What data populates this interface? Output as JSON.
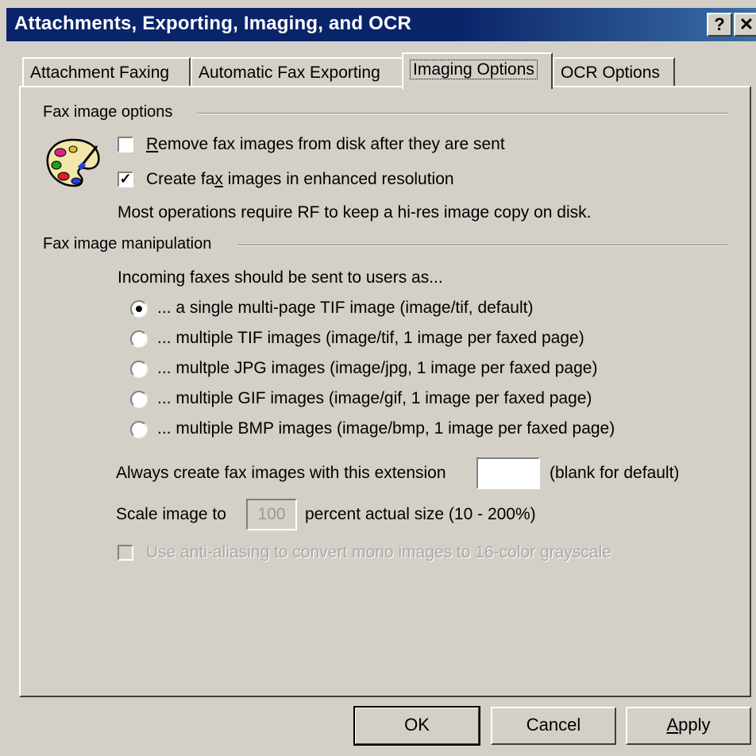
{
  "window": {
    "title": "Attachments, Exporting, Imaging, and OCR",
    "help_glyph": "?",
    "close_glyph": "✕"
  },
  "tabs": [
    {
      "label": "Attachment Faxing",
      "active": false
    },
    {
      "label": "Automatic Fax Exporting",
      "active": false
    },
    {
      "label": "Imaging Options",
      "active": true
    },
    {
      "label": "OCR Options",
      "active": false
    }
  ],
  "fax_image_options": {
    "group_label": "Fax image options",
    "icon": "palette-icon",
    "remove_images": {
      "label_prefix": "",
      "label_underline": "R",
      "label_rest": "emove fax images from disk after they are sent",
      "checked": false
    },
    "enhanced_resolution": {
      "label_prefix": "Create fa",
      "label_underline": "x",
      "label_rest": " images in enhanced resolution",
      "checked": true
    },
    "note": "Most operations require RF to keep a hi-res image copy on disk."
  },
  "fax_image_manipulation": {
    "group_label": "Fax image manipulation",
    "prompt": "Incoming faxes should be sent to users as...",
    "options": [
      {
        "label": "... a single multi-page TIF image (image/tif, default)",
        "selected": true
      },
      {
        "label": "... multiple TIF images (image/tif, 1 image per faxed page)",
        "selected": false
      },
      {
        "label": "... multple JPG images (image/jpg, 1 image per faxed page)",
        "selected": false
      },
      {
        "label": "... multiple GIF images (image/gif, 1 image per faxed page)",
        "selected": false
      },
      {
        "label": "... multiple BMP images (image/bmp, 1 image per faxed page)",
        "selected": false
      }
    ],
    "extension_label": "Always create fax images with this extension",
    "extension_value": "",
    "extension_hint": "(blank for default)",
    "scale_label": "Scale image to",
    "scale_value": "100",
    "scale_hint": "percent actual size (10 - 200%)",
    "antialias_label": "Use anti-aliasing to convert mono images to 16-color grayscale",
    "antialias_checked": false,
    "antialias_enabled": false
  },
  "buttons": {
    "ok": "OK",
    "cancel": "Cancel",
    "apply_underline": "A",
    "apply_rest": "pply"
  }
}
